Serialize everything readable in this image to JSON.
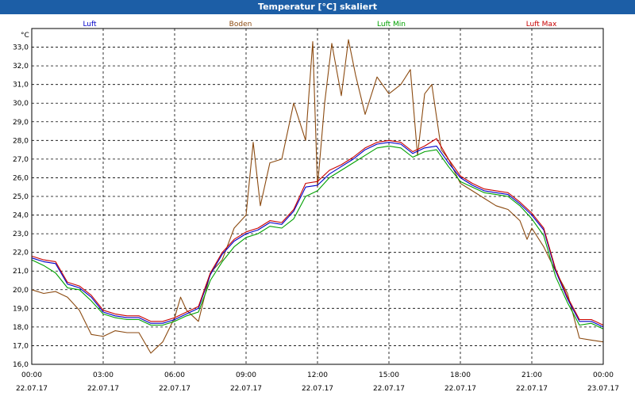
{
  "window": {
    "title": "Temperatur [°C] skaliert"
  },
  "chart_data": {
    "type": "line",
    "title": "Temperatur [°C] skaliert",
    "ylabel": "°C",
    "xlabel": "",
    "ylim": [
      16.0,
      34.0
    ],
    "y_ticks": [
      "16,0",
      "17,0",
      "18,0",
      "19,0",
      "20,0",
      "21,0",
      "22,0",
      "23,0",
      "24,0",
      "25,0",
      "26,0",
      "27,0",
      "28,0",
      "29,0",
      "30,0",
      "31,0",
      "32,0",
      "33,0"
    ],
    "x_ticks": [
      {
        "time": "00:00",
        "date": "22.07.17"
      },
      {
        "time": "03:00",
        "date": "22.07.17"
      },
      {
        "time": "06:00",
        "date": "22.07.17"
      },
      {
        "time": "09:00",
        "date": "22.07.17"
      },
      {
        "time": "12:00",
        "date": "22.07.17"
      },
      {
        "time": "15:00",
        "date": "22.07.17"
      },
      {
        "time": "18:00",
        "date": "22.07.17"
      },
      {
        "time": "21:00",
        "date": "22.07.17"
      },
      {
        "time": "00:00",
        "date": "23.07.17"
      }
    ],
    "xlim_hours": [
      0,
      24
    ],
    "grid": true,
    "legend_position": "top",
    "series": [
      {
        "name": "Luft",
        "color": "#0000c8",
        "points": [
          [
            0,
            21.7
          ],
          [
            0.5,
            21.5
          ],
          [
            1,
            21.4
          ],
          [
            1.5,
            20.3
          ],
          [
            2,
            20.1
          ],
          [
            2.5,
            19.6
          ],
          [
            3,
            18.8
          ],
          [
            3.5,
            18.6
          ],
          [
            4,
            18.5
          ],
          [
            4.5,
            18.5
          ],
          [
            5,
            18.2
          ],
          [
            5.5,
            18.2
          ],
          [
            6,
            18.4
          ],
          [
            6.5,
            18.7
          ],
          [
            7,
            19.0
          ],
          [
            7.5,
            20.8
          ],
          [
            8,
            21.9
          ],
          [
            8.5,
            22.6
          ],
          [
            9,
            23.0
          ],
          [
            9.5,
            23.2
          ],
          [
            10,
            23.6
          ],
          [
            10.5,
            23.5
          ],
          [
            11,
            24.2
          ],
          [
            11.5,
            25.5
          ],
          [
            12,
            25.6
          ],
          [
            12.5,
            26.2
          ],
          [
            13,
            26.6
          ],
          [
            13.5,
            27.0
          ],
          [
            14,
            27.5
          ],
          [
            14.5,
            27.8
          ],
          [
            15,
            27.9
          ],
          [
            15.5,
            27.8
          ],
          [
            16,
            27.3
          ],
          [
            16.5,
            27.6
          ],
          [
            17,
            27.7
          ],
          [
            17.5,
            26.8
          ],
          [
            18,
            26.0
          ],
          [
            18.5,
            25.6
          ],
          [
            19,
            25.3
          ],
          [
            19.5,
            25.2
          ],
          [
            20,
            25.1
          ],
          [
            20.5,
            24.6
          ],
          [
            21,
            24.0
          ],
          [
            21.5,
            23.2
          ],
          [
            22,
            21.0
          ],
          [
            22.5,
            19.5
          ],
          [
            23,
            18.3
          ],
          [
            23.5,
            18.3
          ],
          [
            24,
            18.0
          ]
        ]
      },
      {
        "name": "Boden",
        "color": "#8b4a10",
        "points": [
          [
            0,
            20.0
          ],
          [
            0.5,
            19.8
          ],
          [
            1,
            19.9
          ],
          [
            1.5,
            19.6
          ],
          [
            2,
            18.9
          ],
          [
            2.5,
            17.6
          ],
          [
            3,
            17.5
          ],
          [
            3.5,
            17.8
          ],
          [
            4,
            17.7
          ],
          [
            4.5,
            17.7
          ],
          [
            5,
            16.6
          ],
          [
            5.5,
            17.2
          ],
          [
            6,
            18.5
          ],
          [
            6.25,
            19.6
          ],
          [
            6.5,
            18.9
          ],
          [
            7,
            18.3
          ],
          [
            7.5,
            20.9
          ],
          [
            8,
            21.6
          ],
          [
            8.5,
            23.3
          ],
          [
            9,
            24.0
          ],
          [
            9.3,
            27.9
          ],
          [
            9.6,
            24.5
          ],
          [
            10,
            26.8
          ],
          [
            10.5,
            27.0
          ],
          [
            11,
            30.0
          ],
          [
            11.5,
            28.0
          ],
          [
            11.8,
            33.3
          ],
          [
            12,
            25.5
          ],
          [
            12.3,
            30.0
          ],
          [
            12.6,
            33.2
          ],
          [
            13,
            30.4
          ],
          [
            13.3,
            33.4
          ],
          [
            13.6,
            31.5
          ],
          [
            14,
            29.4
          ],
          [
            14.5,
            31.4
          ],
          [
            15,
            30.5
          ],
          [
            15.5,
            31.0
          ],
          [
            15.9,
            31.8
          ],
          [
            16.2,
            27.2
          ],
          [
            16.5,
            30.5
          ],
          [
            16.8,
            31.0
          ],
          [
            17.2,
            27.5
          ],
          [
            17.5,
            27.0
          ],
          [
            18,
            25.7
          ],
          [
            18.5,
            25.3
          ],
          [
            19,
            24.9
          ],
          [
            19.5,
            24.5
          ],
          [
            20,
            24.3
          ],
          [
            20.5,
            23.7
          ],
          [
            20.8,
            22.7
          ],
          [
            21,
            23.3
          ],
          [
            21.5,
            22.3
          ],
          [
            22,
            21.0
          ],
          [
            22.5,
            19.8
          ],
          [
            23,
            17.4
          ],
          [
            23.5,
            17.3
          ],
          [
            24,
            17.2
          ]
        ]
      },
      {
        "name": "Luft Min",
        "color": "#00a000",
        "points": [
          [
            0,
            21.6
          ],
          [
            0.5,
            21.3
          ],
          [
            1,
            20.9
          ],
          [
            1.5,
            20.1
          ],
          [
            2,
            20.0
          ],
          [
            2.5,
            19.4
          ],
          [
            3,
            18.7
          ],
          [
            3.5,
            18.5
          ],
          [
            4,
            18.4
          ],
          [
            4.5,
            18.4
          ],
          [
            5,
            18.1
          ],
          [
            5.5,
            18.1
          ],
          [
            6,
            18.3
          ],
          [
            6.5,
            18.6
          ],
          [
            7,
            18.8
          ],
          [
            7.5,
            20.5
          ],
          [
            8,
            21.5
          ],
          [
            8.5,
            22.3
          ],
          [
            9,
            22.8
          ],
          [
            9.5,
            23.0
          ],
          [
            10,
            23.4
          ],
          [
            10.5,
            23.3
          ],
          [
            11,
            23.8
          ],
          [
            11.5,
            25.0
          ],
          [
            12,
            25.3
          ],
          [
            12.5,
            26.0
          ],
          [
            13,
            26.4
          ],
          [
            13.5,
            26.8
          ],
          [
            14,
            27.2
          ],
          [
            14.5,
            27.6
          ],
          [
            15,
            27.7
          ],
          [
            15.5,
            27.6
          ],
          [
            16,
            27.1
          ],
          [
            16.5,
            27.4
          ],
          [
            17,
            27.5
          ],
          [
            17.5,
            26.6
          ],
          [
            18,
            25.8
          ],
          [
            18.5,
            25.5
          ],
          [
            19,
            25.2
          ],
          [
            19.5,
            25.1
          ],
          [
            20,
            25.0
          ],
          [
            20.5,
            24.5
          ],
          [
            21,
            23.8
          ],
          [
            21.5,
            22.9
          ],
          [
            22,
            20.7
          ],
          [
            22.5,
            19.3
          ],
          [
            23,
            18.1
          ],
          [
            23.5,
            18.2
          ],
          [
            24,
            17.9
          ]
        ]
      },
      {
        "name": "Luft Max",
        "color": "#c80000",
        "points": [
          [
            0,
            21.8
          ],
          [
            0.5,
            21.6
          ],
          [
            1,
            21.5
          ],
          [
            1.5,
            20.4
          ],
          [
            2,
            20.2
          ],
          [
            2.5,
            19.7
          ],
          [
            3,
            18.9
          ],
          [
            3.5,
            18.7
          ],
          [
            4,
            18.6
          ],
          [
            4.5,
            18.6
          ],
          [
            5,
            18.3
          ],
          [
            5.5,
            18.3
          ],
          [
            6,
            18.5
          ],
          [
            6.5,
            18.8
          ],
          [
            7,
            19.1
          ],
          [
            7.5,
            20.9
          ],
          [
            8,
            22.0
          ],
          [
            8.5,
            22.7
          ],
          [
            9,
            23.1
          ],
          [
            9.5,
            23.3
          ],
          [
            10,
            23.7
          ],
          [
            10.5,
            23.6
          ],
          [
            11,
            24.3
          ],
          [
            11.5,
            25.7
          ],
          [
            12,
            25.8
          ],
          [
            12.5,
            26.4
          ],
          [
            13,
            26.7
          ],
          [
            13.5,
            27.1
          ],
          [
            14,
            27.6
          ],
          [
            14.5,
            27.9
          ],
          [
            15,
            28.0
          ],
          [
            15.5,
            27.9
          ],
          [
            16,
            27.4
          ],
          [
            16.5,
            27.7
          ],
          [
            17,
            28.1
          ],
          [
            17.5,
            27.0
          ],
          [
            18,
            26.1
          ],
          [
            18.5,
            25.7
          ],
          [
            19,
            25.4
          ],
          [
            19.5,
            25.3
          ],
          [
            20,
            25.2
          ],
          [
            20.5,
            24.7
          ],
          [
            21,
            24.1
          ],
          [
            21.5,
            23.3
          ],
          [
            22,
            21.1
          ],
          [
            22.5,
            19.6
          ],
          [
            23,
            18.4
          ],
          [
            23.5,
            18.4
          ],
          [
            24,
            18.1
          ]
        ]
      }
    ]
  }
}
